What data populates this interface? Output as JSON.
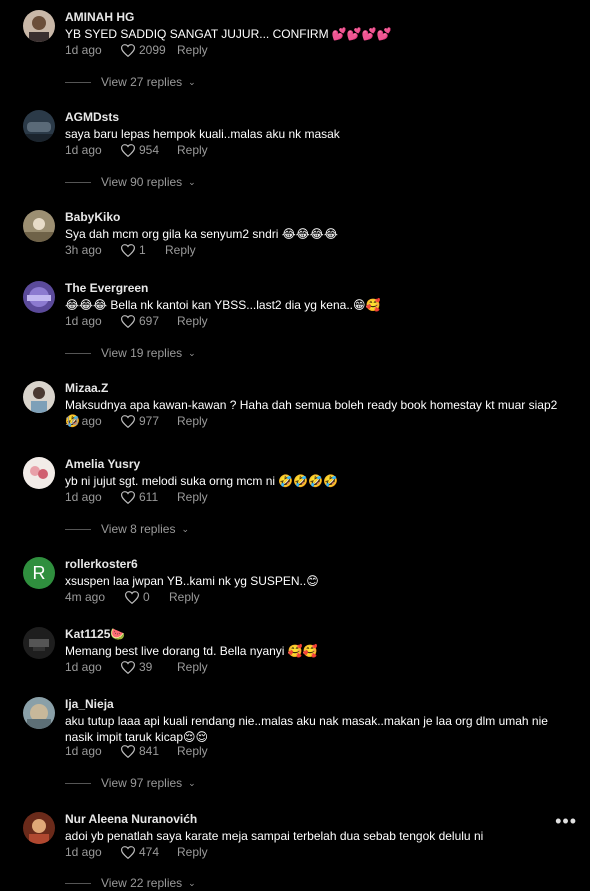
{
  "comments": [
    {
      "username": "AMINAH HG",
      "text": "YB SYED SADDIQ SANGAT JUJUR... CONFIRM 💕💕💕💕",
      "age": "1d ago",
      "likes": "2099",
      "reply": "Reply",
      "replies": "View 27 replies"
    },
    {
      "username": "AGMDsts",
      "text": "saya baru lepas hempok kuali..malas aku nk masak",
      "age": "1d ago",
      "likes": "954",
      "reply": "Reply",
      "replies": "View 90 replies"
    },
    {
      "username": "BabyKiko",
      "text": "Sya dah mcm org gila ka senyum2 sndri 😂😂😂😂",
      "age": "3h ago",
      "likes": "1",
      "reply": "Reply",
      "replies": ""
    },
    {
      "username": "The Evergreen",
      "text": "😂😂😂 Bella nk kantoi kan YBSS...last2 dia yg kena..😁🥰",
      "age": "1d ago",
      "likes": "697",
      "reply": "Reply",
      "replies": "View 19 replies"
    },
    {
      "username": "Mizaa.Z",
      "text": "Maksudnya apa kawan-kawan ? Haha dah semua boleh ready book homestay kt muar siap2 🤣",
      "age": "1d ago",
      "likes": "977",
      "reply": "Reply",
      "replies": ""
    },
    {
      "username": "Amelia Yusry",
      "text": "yb ni jujut sgt. melodi suka orng mcm ni 🤣🤣🤣🤣",
      "age": "1d ago",
      "likes": "611",
      "reply": "Reply",
      "replies": "View 8 replies"
    },
    {
      "username": "rollerkoster6",
      "text": "xsuspen laa jwpan YB..kami nk yg SUSPEN..😊",
      "age": "4m ago",
      "likes": "0",
      "reply": "Reply",
      "replies": "",
      "avatar_letter": "R"
    },
    {
      "username": "Kat1125🍉",
      "text": "Memang best live dorang td. Bella nyanyi 🥰🥰",
      "age": "1d ago",
      "likes": "39",
      "reply": "Reply",
      "replies": ""
    },
    {
      "username": "Ija_Nieja",
      "text": "aku tutup laaa api kuali rendang nie..malas aku nak masak..makan je laa org dlm umah nie nasik impit taruk kicap😌😌",
      "age": "1d ago",
      "likes": "841",
      "reply": "Reply",
      "replies": "View 97 replies"
    },
    {
      "username": "Nur Aleena Nuranovićh",
      "text": "adoi yb penatlah saya karate meja sampai terbelah dua sebab tengok delulu ni",
      "age": "1d ago",
      "likes": "474",
      "reply": "Reply",
      "replies": "View 22 replies"
    }
  ],
  "more_icon": "more-horizontal-icon",
  "like_icon": "heart-outline-icon"
}
